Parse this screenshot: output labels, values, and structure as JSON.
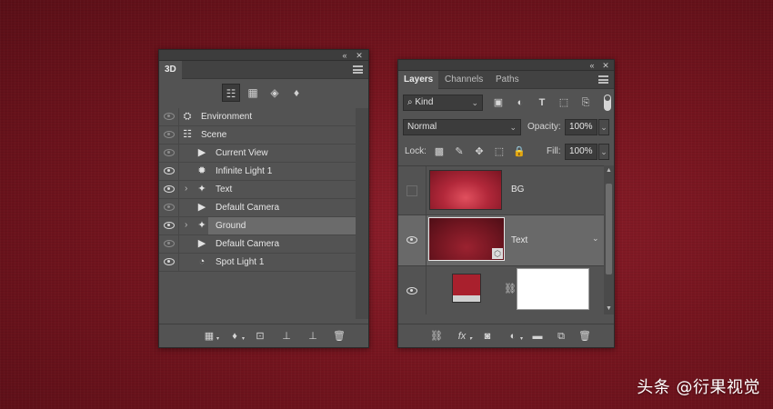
{
  "panel_3d": {
    "tab": "3D",
    "filters": [
      {
        "icon": "scene-tree-icon",
        "glyph": "☷",
        "active": true
      },
      {
        "icon": "mesh-icon",
        "glyph": "▦",
        "active": false
      },
      {
        "icon": "material-icon",
        "glyph": "◈",
        "active": false
      },
      {
        "icon": "light-bulb-icon",
        "glyph": "♦",
        "active": false
      }
    ],
    "rows": [
      {
        "label": "Environment",
        "icon": "environment-icon",
        "glyph": "⛭",
        "eye_dim": true,
        "expand": false,
        "indent": 0
      },
      {
        "label": "Scene",
        "icon": "scene-icon",
        "glyph": "☷",
        "eye_dim": true,
        "expand": false,
        "indent": 0
      },
      {
        "label": "Current View",
        "icon": "camera-icon",
        "glyph": "▶",
        "eye_dim": true,
        "expand": false,
        "indent": 1
      },
      {
        "label": "Infinite Light 1",
        "icon": "infinite-light-icon",
        "glyph": "✹",
        "eye_dim": false,
        "expand": false,
        "indent": 1
      },
      {
        "label": "Text",
        "icon": "mesh-star-icon",
        "glyph": "✦",
        "eye_dim": false,
        "expand": true,
        "indent": 1
      },
      {
        "label": "Default Camera",
        "icon": "camera-icon",
        "glyph": "▶",
        "eye_dim": true,
        "expand": false,
        "indent": 1
      },
      {
        "label": "Ground",
        "icon": "mesh-star-icon",
        "glyph": "✦",
        "eye_dim": false,
        "expand": true,
        "indent": 1,
        "selected": true
      },
      {
        "label": "Default Camera",
        "icon": "camera-icon",
        "glyph": "▶",
        "eye_dim": true,
        "expand": false,
        "indent": 1
      },
      {
        "label": "Spot Light 1",
        "icon": "spot-light-icon",
        "glyph": "◔",
        "eye_dim": false,
        "expand": false,
        "indent": 1
      }
    ],
    "bottom_buttons": [
      {
        "icon": "mesh-new-icon",
        "glyph": "▦",
        "dropdown": true
      },
      {
        "icon": "add-light-icon",
        "glyph": "♦",
        "dropdown": true
      },
      {
        "icon": "material-drop-icon",
        "glyph": "⊡",
        "dropdown": false
      },
      {
        "icon": "drop-to-plane-icon",
        "glyph": "⊥",
        "dropdown": false
      },
      {
        "icon": "render-icon",
        "glyph": "⊥",
        "dropdown": false
      },
      {
        "icon": "trash-icon",
        "glyph": "🗑",
        "dropdown": false
      }
    ]
  },
  "panel_layers": {
    "tabs": [
      "Layers",
      "Channels",
      "Paths"
    ],
    "active_tab": "Layers",
    "kind_label": "Kind",
    "filter_icons": [
      {
        "icon": "pixel-filter-icon",
        "glyph": "▣"
      },
      {
        "icon": "adjustment-filter-icon",
        "glyph": "◐"
      },
      {
        "icon": "type-filter-icon",
        "glyph": "T"
      },
      {
        "icon": "shape-filter-icon",
        "glyph": "⬚"
      },
      {
        "icon": "smart-object-filter-icon",
        "glyph": "⎘"
      }
    ],
    "blend_mode": "Normal",
    "opacity_label": "Opacity:",
    "opacity_value": "100%",
    "lock_label": "Lock:",
    "lock_icons": [
      {
        "icon": "lock-transparent-icon",
        "glyph": "▩"
      },
      {
        "icon": "lock-brush-icon",
        "glyph": "✎"
      },
      {
        "icon": "lock-position-icon",
        "glyph": "✥"
      },
      {
        "icon": "lock-artboard-icon",
        "glyph": "⬚"
      },
      {
        "icon": "lock-all-icon",
        "glyph": "🔒"
      }
    ],
    "fill_label": "Fill:",
    "fill_value": "100%",
    "layers": [
      {
        "name": "BG",
        "visible": false,
        "selected": false
      },
      {
        "name": "Text",
        "visible": true,
        "selected": true
      },
      {
        "name": "",
        "visible": true,
        "selected": false
      }
    ],
    "bottom_buttons": [
      {
        "icon": "link-icon",
        "glyph": "⛓"
      },
      {
        "icon": "fx-icon",
        "glyph": "fx"
      },
      {
        "icon": "mask-icon",
        "glyph": "◙"
      },
      {
        "icon": "adjustment-layer-icon",
        "glyph": "◐"
      },
      {
        "icon": "folder-icon",
        "glyph": "▬"
      },
      {
        "icon": "new-layer-icon",
        "glyph": "⧉"
      },
      {
        "icon": "trash-icon",
        "glyph": "🗑"
      }
    ]
  },
  "watermark": "头条 @衍果视觉",
  "colors": {
    "panel_bg": "#535353",
    "selected_row": "#6b6b6b",
    "canvas_red": "#7a1a24"
  }
}
